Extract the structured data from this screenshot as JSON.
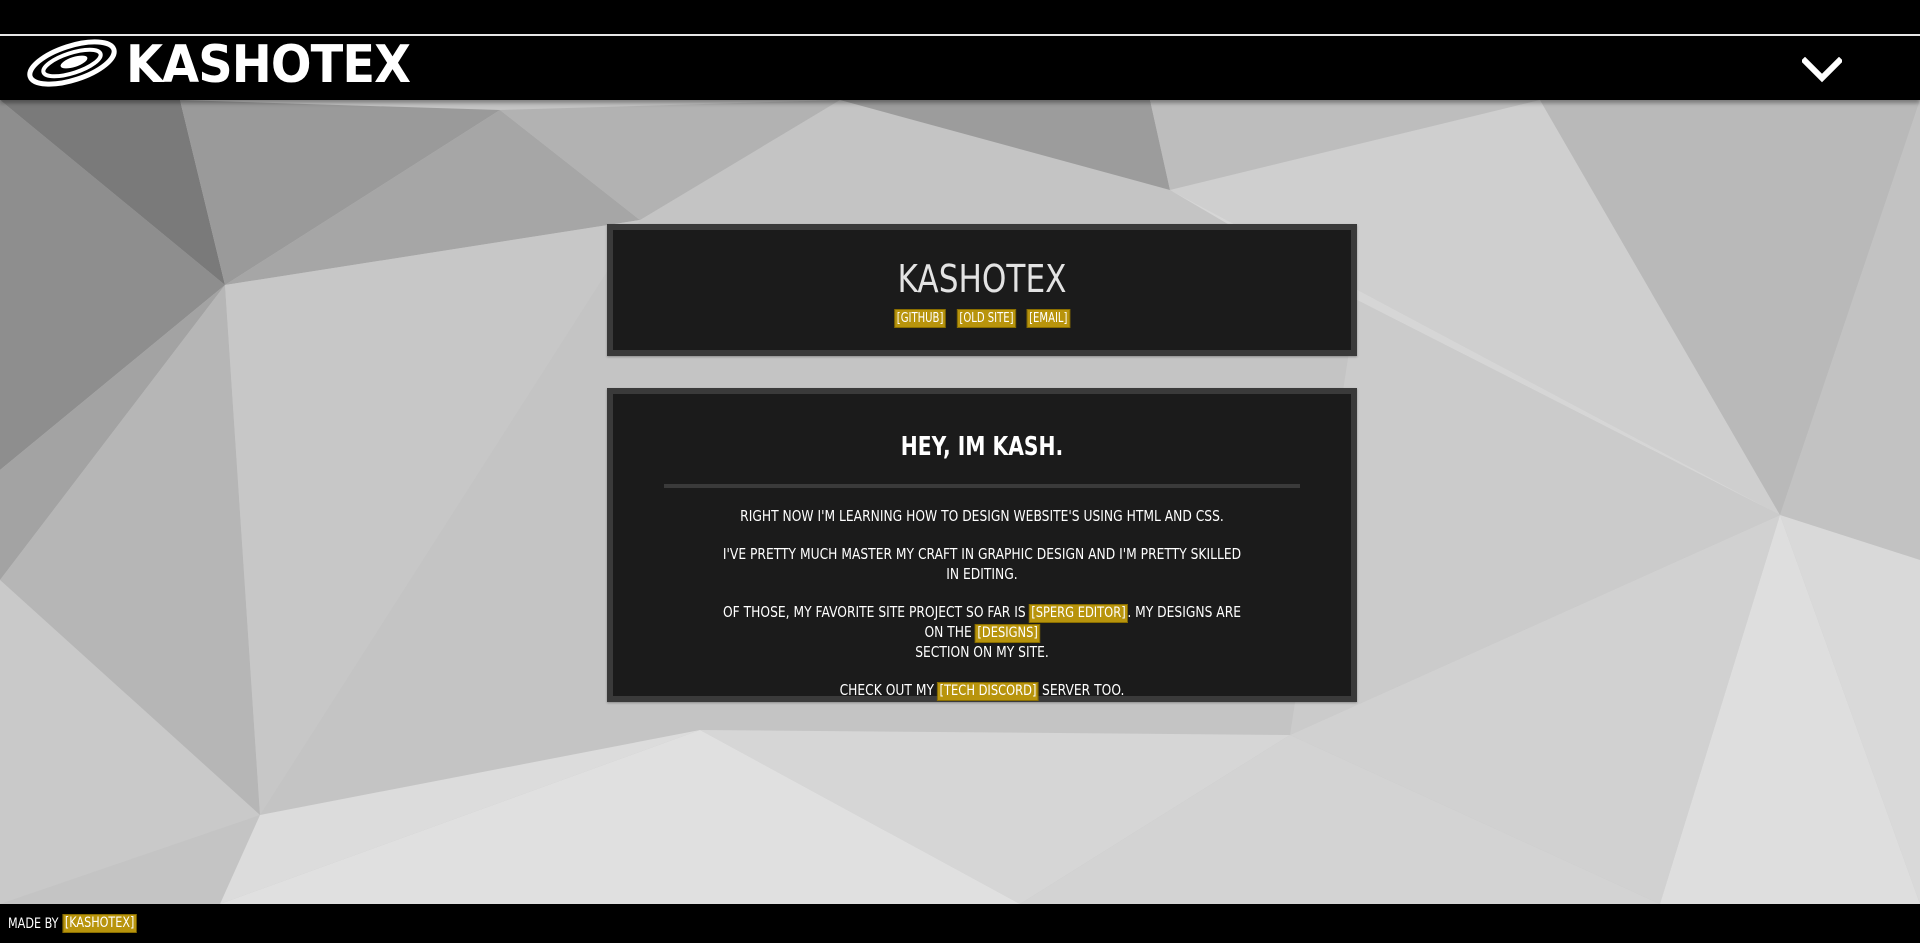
{
  "header": {
    "logo_text": "KASHOTEX",
    "logo_icon": "swirl-logo-icon",
    "menu_icon": "chevron-down-icon"
  },
  "intro_panel": {
    "title": "KASHOTEX",
    "links": [
      {
        "label": "[GITHUB]"
      },
      {
        "label": "[OLD SITE]"
      },
      {
        "label": "[EMAIL]"
      }
    ]
  },
  "about_panel": {
    "heading": "HEY, IM KASH.",
    "para1": "RIGHT NOW I'M LEARNING HOW TO DESIGN WEBSITE'S USING HTML AND CSS.",
    "para2": "I'VE PRETTY MUCH MASTER MY CRAFT IN GRAPHIC DESIGN AND I'M PRETTY SKILLED IN EDITING.",
    "para3_a": "OF THOSE, MY FAVORITE SITE PROJECT SO FAR IS",
    "para3_link1": "[SPERG EDITOR]",
    "para3_b": ". MY DESIGNS ARE ON THE",
    "para3_link2": "[DESIGNS]",
    "para3_c": "SECTION ON MY SITE.",
    "para4_a": "CHECK OUT MY",
    "para4_link": "[TECH DISCORD]",
    "para4_b": "SERVER TOO."
  },
  "footer": {
    "made_by": "MADE BY",
    "author_link": "[KASHOTEX]"
  },
  "colors": {
    "accent": "#b8940c",
    "panel_bg": "#1b1b1b",
    "panel_border": "#3a3a3a",
    "bar_bg": "#000000"
  }
}
